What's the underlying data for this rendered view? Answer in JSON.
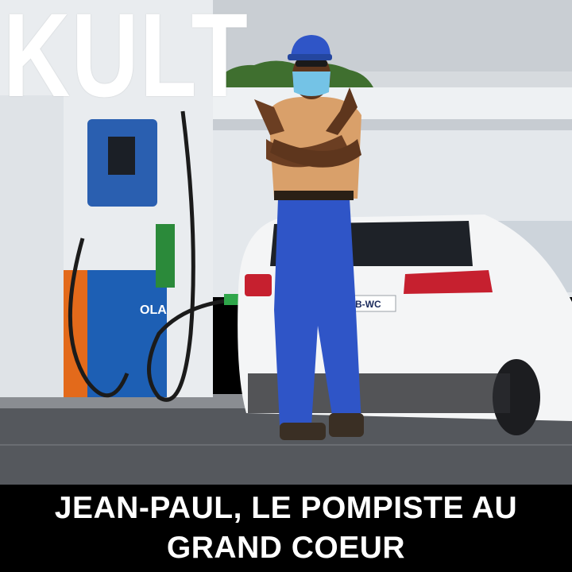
{
  "brand": {
    "logo_text": "KULT"
  },
  "caption": {
    "title": "JEAN-PAUL, LE POMPISTE AU GRAND COEUR"
  },
  "scene": {
    "pump_brand_text": "OLA",
    "license_plate_text": "B-WC",
    "colors": {
      "sky": "#d9dde2",
      "canopy": "#eef1f3",
      "road": "#56595e",
      "pump_blue": "#1d5fb4",
      "pump_orange": "#e36a1b",
      "uniform_blue": "#2f55c7",
      "shirt": "#d9a06a",
      "mask": "#74c3e6",
      "car": "#f4f5f6",
      "trees": "#3f6f2f"
    }
  }
}
